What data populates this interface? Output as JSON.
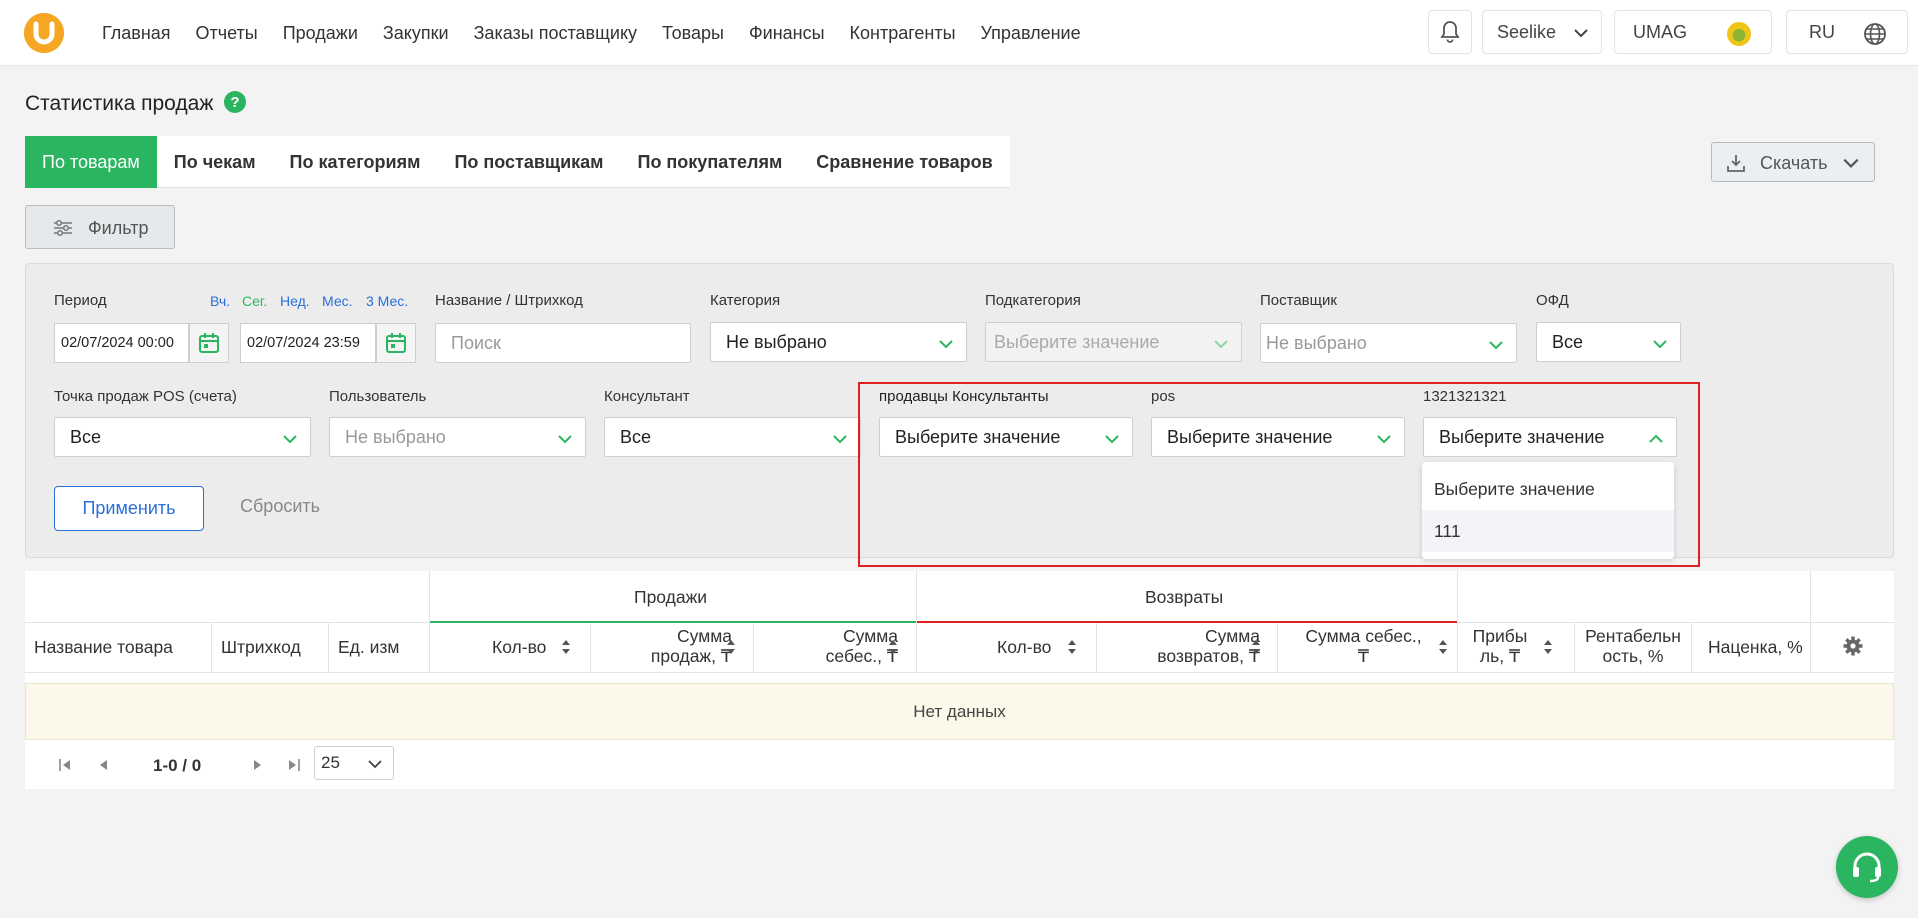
{
  "nav": {
    "items": [
      "Главная",
      "Отчеты",
      "Продажи",
      "Закупки",
      "Заказы поставщику",
      "Товары",
      "Финансы",
      "Контрагенты",
      "Управление"
    ],
    "company": "Seelike",
    "brand": "UMAG",
    "lang": "RU"
  },
  "page": {
    "title": "Статистика продаж",
    "tabs": [
      "По товарам",
      "По чекам",
      "По категориям",
      "По поставщикам",
      "По покупателям",
      "Сравнение товаров"
    ],
    "active_tab": "По товарам",
    "download_label": "Скачать",
    "filter_label": "Фильтр"
  },
  "filters": {
    "period_label": "Период",
    "quick": [
      "Вч.",
      "Сег.",
      "Нед.",
      "Мес.",
      "3 Мес."
    ],
    "date_from": "02/07/2024 00:00",
    "date_to": "02/07/2024 23:59",
    "name_label": "Название / Штрихкод",
    "name_placeholder": "Поиск",
    "category_label": "Категория",
    "category_value": "Не выбрано",
    "subcategory_label": "Подкатегория",
    "subcategory_value": "Выберите значение",
    "supplier_label": "Поставщик",
    "supplier_value": "Не выбрано",
    "ofd_label": "ОФД",
    "ofd_value": "Все",
    "pos_label": "Точка продаж POS (счета)",
    "pos_value": "Все",
    "user_label": "Пользователь",
    "user_value": "Не выбрано",
    "consultant_label": "Консультант",
    "consultant_value": "Все",
    "custom1_label": "продавцы Консультанты",
    "custom1_value": "Выберите значение",
    "custom2_label": "pos",
    "custom2_value": "Выберите значение",
    "custom3_label": "1321321321",
    "custom3_value": "Выберите значение",
    "dropdown_options": [
      "Выберите значение",
      "111"
    ],
    "apply_label": "Применить",
    "reset_label": "Сбросить"
  },
  "table": {
    "group_sales": "Продажи",
    "group_returns": "Возвраты",
    "columns": {
      "name": "Название товара",
      "barcode": "Штрихкод",
      "unit": "Ед. изм",
      "qty": "Кол-во",
      "sales_sum_1": "Сумма",
      "sales_sum_2": "продаж, ₸",
      "cost_1": "Сумма",
      "cost_2": "себес., ₸",
      "ret_qty": "Кол-во",
      "ret_sum_1": "Сумма",
      "ret_sum_2": "возвратов, ₸",
      "ret_cost_1": "Сумма себес.,",
      "ret_cost_2": "₸",
      "profit_1": "Прибы",
      "profit_2": "ль, ₸",
      "rent_1": "Рентабельн",
      "rent_2": "ость, %",
      "markup": "Наценка, %"
    },
    "empty_text": "Нет данных",
    "pager_text": "1-0 / 0",
    "page_size": "25"
  },
  "colors": {
    "brand_green": "#2cb561",
    "brand_orange": "#f5a623",
    "link_blue": "#2a6fdb",
    "highlight_red": "#e02020"
  }
}
